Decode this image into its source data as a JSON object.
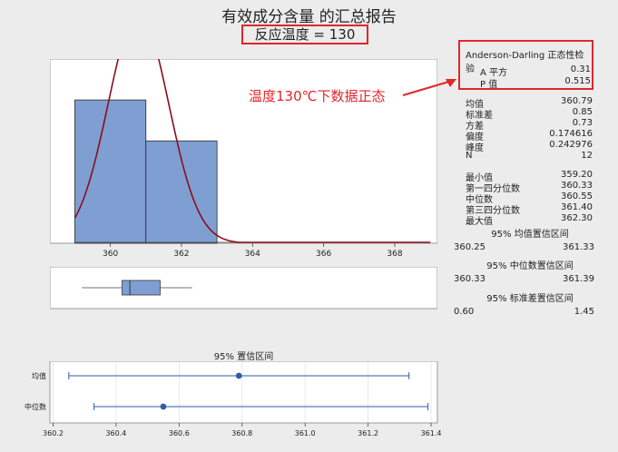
{
  "header": {
    "title": "有效成分含量 的汇总报告",
    "subtitle": "反应温度 = 130"
  },
  "annotation": {
    "text": "温度130℃下数据正态",
    "color": "#e0262b"
  },
  "colors": {
    "bar_fill": "#7f9fd3",
    "bar_stroke": "#2b2b2b",
    "curve": "#8b0d1e",
    "interval": "#2e5da8",
    "highlight": "#e0262b"
  },
  "normality_test": {
    "title": "Anderson-Darling 正态性检验",
    "rows": [
      {
        "label": "A 平方",
        "value": "0.31"
      },
      {
        "label": "P 值",
        "value": "0.515"
      }
    ]
  },
  "stats": {
    "group1": [
      {
        "label": "均值",
        "value": "360.79"
      },
      {
        "label": "标准差",
        "value": "0.85"
      },
      {
        "label": "方差",
        "value": "0.73"
      },
      {
        "label": "偏度",
        "value": "0.174616"
      },
      {
        "label": "峰度",
        "value": "0.242976"
      },
      {
        "label": "N",
        "value": "12"
      }
    ],
    "group2": [
      {
        "label": "最小值",
        "value": "359.20"
      },
      {
        "label": "第一四分位数",
        "value": "360.33"
      },
      {
        "label": "中位数",
        "value": "360.55"
      },
      {
        "label": "第三四分位数",
        "value": "361.40"
      },
      {
        "label": "最大值",
        "value": "362.30"
      }
    ],
    "ci_mean": {
      "title": "95% 均值置信区间",
      "low": "360.25",
      "high": "361.33"
    },
    "ci_median": {
      "title": "95% 中位数置信区间",
      "low": "360.33",
      "high": "361.39"
    },
    "ci_sd": {
      "title": "95% 标准差置信区间",
      "low": "0.60",
      "high": "1.45"
    }
  },
  "chart_data": [
    {
      "type": "bar",
      "chart": "histogram",
      "bins": [
        {
          "start": 359,
          "end": 361,
          "count": 7
        },
        {
          "start": 361,
          "end": 363,
          "count": 5
        }
      ],
      "x_ticks": [
        360,
        362,
        364,
        366,
        368
      ],
      "xlim": [
        358.3,
        369.2
      ],
      "ylim": [
        0,
        9
      ],
      "normal_fit": {
        "mean": 360.79,
        "sd": 0.85
      },
      "grid": false
    },
    {
      "type": "boxplot",
      "min": 359.2,
      "q1": 360.33,
      "median": 360.55,
      "q3": 361.4,
      "max": 362.3,
      "xlim": [
        358.3,
        369.2
      ]
    },
    {
      "type": "scatter",
      "chart": "confidence-intervals",
      "title": "95% 置信区间",
      "categories": [
        "均值",
        "中位数"
      ],
      "points": [
        {
          "label": "均值",
          "estimate": 360.79,
          "low": 360.25,
          "high": 361.33
        },
        {
          "label": "中位数",
          "estimate": 360.55,
          "low": 360.33,
          "high": 361.39
        }
      ],
      "x_ticks": [
        "360.2",
        "360.4",
        "360.6",
        "360.8",
        "361.0",
        "361.2",
        "361.4"
      ],
      "xlim": [
        360.19,
        361.42
      ],
      "grid": true
    }
  ]
}
